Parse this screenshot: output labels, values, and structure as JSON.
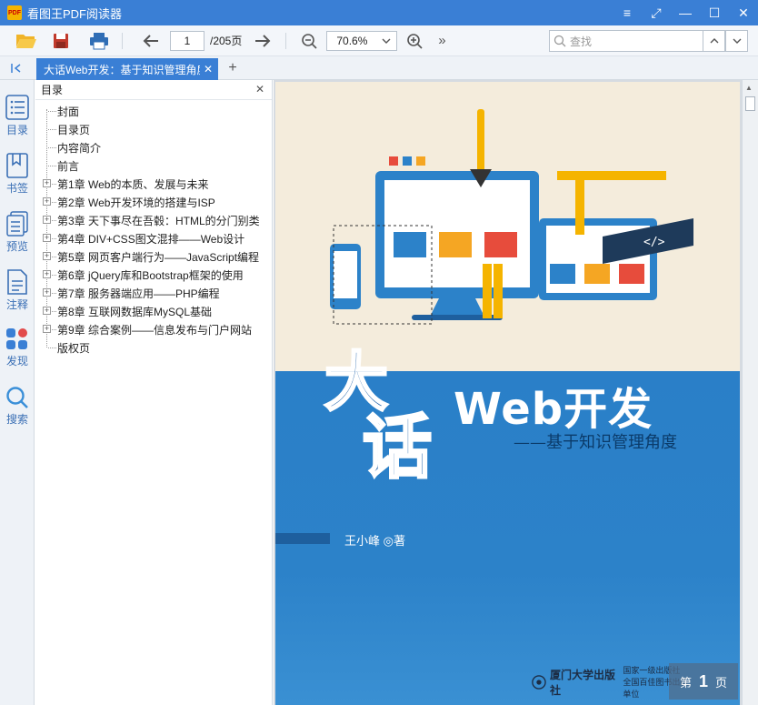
{
  "app": {
    "title": "看图王PDF阅读器",
    "logo_text": "PDF"
  },
  "window_controls": {
    "menu": "≡",
    "fullscreen": "⤢",
    "minimize": "—",
    "maximize": "☐",
    "close": "✕"
  },
  "toolbar": {
    "page_current": "1",
    "page_total": "/205页",
    "zoom": "70.6%",
    "search_placeholder": "查找",
    "more": "»"
  },
  "tabs": [
    {
      "label": "大话Web开发：基于知识管理角度",
      "close": "✕"
    }
  ],
  "tab_add": "+",
  "rail": [
    {
      "label": "目录",
      "icon": "list-icon"
    },
    {
      "label": "书签",
      "icon": "bookmark-icon"
    },
    {
      "label": "预览",
      "icon": "preview-icon"
    },
    {
      "label": "注释",
      "icon": "annotation-icon"
    },
    {
      "label": "发现",
      "icon": "discover-icon"
    },
    {
      "label": "搜索",
      "icon": "search-icon"
    }
  ],
  "toc": {
    "title": "目录",
    "items": [
      {
        "label": "封面",
        "expandable": false
      },
      {
        "label": "目录页",
        "expandable": false
      },
      {
        "label": "内容简介",
        "expandable": false
      },
      {
        "label": "前言",
        "expandable": false
      },
      {
        "label": "第1章 Web的本质、发展与未来",
        "expandable": true
      },
      {
        "label": "第2章 Web开发环境的搭建与ISP",
        "expandable": true
      },
      {
        "label": "第3章 天下事尽在吾毂：HTML的分门别类",
        "expandable": true
      },
      {
        "label": "第4章 DIV+CSS图文混排——Web设计",
        "expandable": true
      },
      {
        "label": "第5章 网页客户端行为——JavaScript编程",
        "expandable": true
      },
      {
        "label": "第6章 jQuery库和Bootstrap框架的使用",
        "expandable": true
      },
      {
        "label": "第7章 服务器端应用——PHP编程",
        "expandable": true
      },
      {
        "label": "第8章 互联网数据库MySQL基础",
        "expandable": true
      },
      {
        "label": "第9章 综合案例——信息发布与门户网站",
        "expandable": true
      },
      {
        "label": "版权页",
        "expandable": false
      }
    ]
  },
  "cover": {
    "big_char_1": "大",
    "big_char_2": "话",
    "title": "Web开发",
    "subtitle": "——基于知识管理角度",
    "author": "王小峰 ◎著",
    "code_tag": "</>",
    "publisher_line1": "厦门大学出版社",
    "publisher_line2": "国家一级出版社",
    "publisher_line3": "全国百佳图书出版单位"
  },
  "page_badge": {
    "prefix": "第",
    "number": "1",
    "suffix": "页"
  }
}
